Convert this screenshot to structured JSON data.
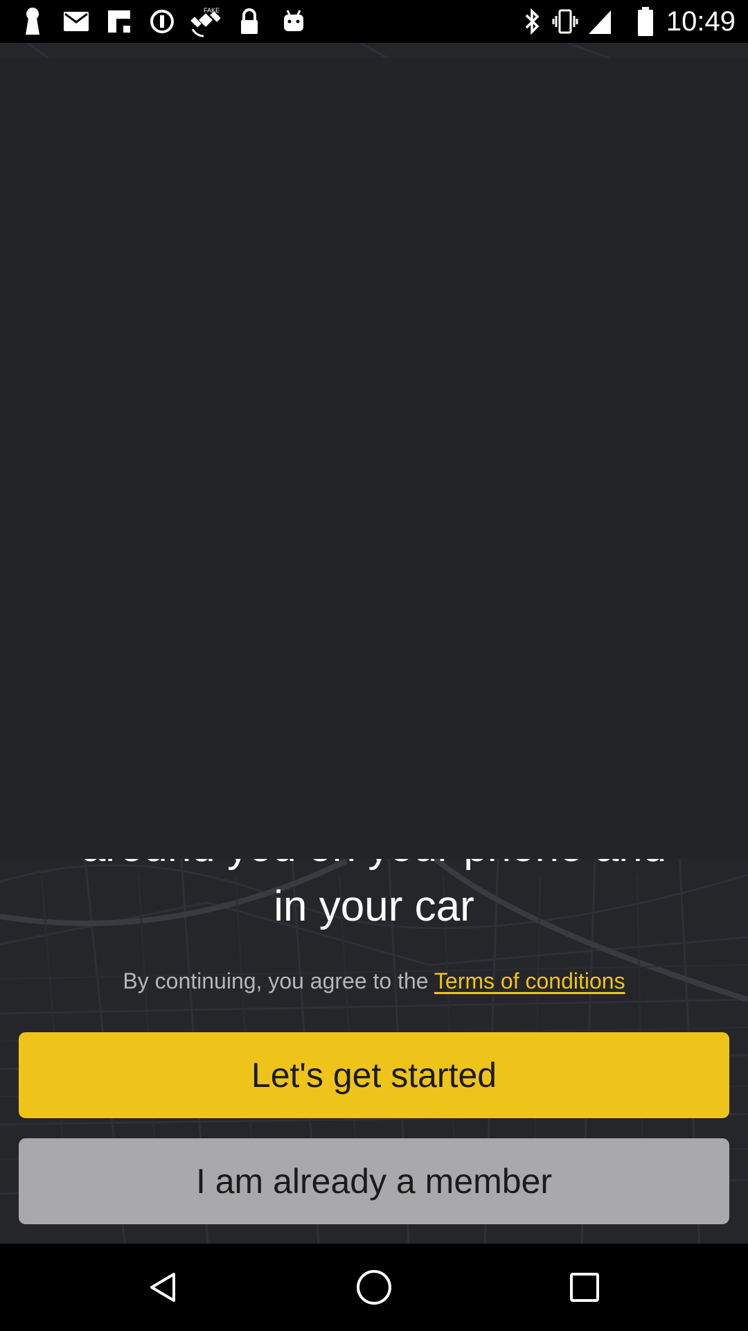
{
  "status_bar": {
    "time": "10:49",
    "left_icons": [
      "keyhole-icon",
      "email-icon",
      "flipboard-icon",
      "info-circle-icon",
      "satellite-icon",
      "lock-icon",
      "android-icon"
    ],
    "right_icons": [
      "bluetooth-icon",
      "vibrate-icon",
      "signal-icon",
      "battery-icon"
    ]
  },
  "onboarding": {
    "tagline_partial": "around you on your phone and",
    "tagline_last": "in your car",
    "terms_prefix": "By continuing, you agree to the ",
    "terms_link": "Terms of conditions"
  },
  "buttons": {
    "start_label": "Let's get started",
    "member_label": "I am already a member"
  },
  "colors": {
    "accent": "#efc41a",
    "secondary_button": "#a9a9ab",
    "background": "#222327"
  },
  "nav_bar": {
    "icons": [
      "back-icon",
      "home-icon",
      "recents-icon"
    ]
  }
}
